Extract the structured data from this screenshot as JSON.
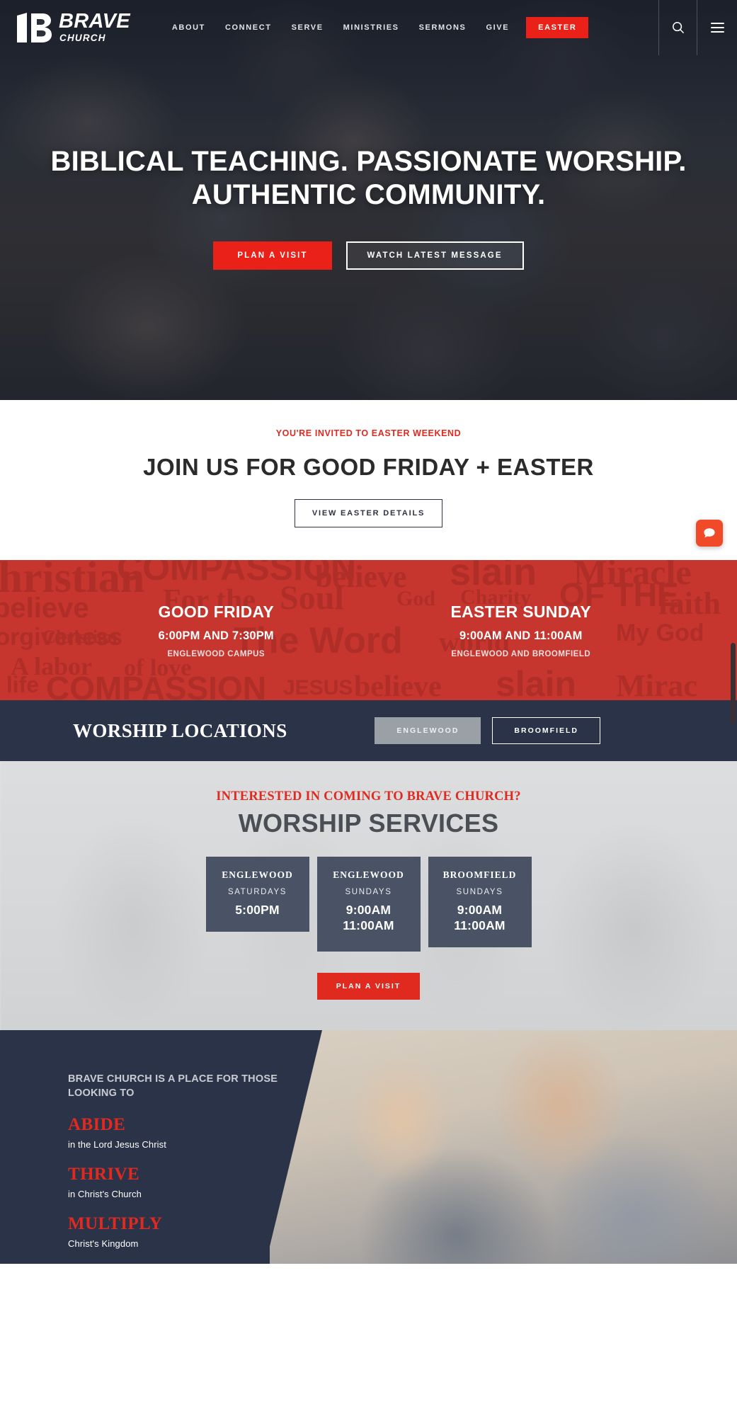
{
  "nav": {
    "logo": {
      "brand": "BRAVE",
      "sub": "CHURCH",
      "mark_icon": "brave-b-logo-icon"
    },
    "links": [
      "ABOUT",
      "CONNECT",
      "SERVE",
      "MINISTRIES",
      "SERMONS",
      "GIVE"
    ],
    "cta": "EASTER",
    "search_icon": "search-icon",
    "menu_icon": "hamburger-menu-icon"
  },
  "hero": {
    "title_line1": "BIBLICAL TEACHING. PASSIONATE WORSHIP.",
    "title_line2": "AUTHENTIC COMMUNITY.",
    "primary_button": "PLAN A VISIT",
    "secondary_button": "WATCH LATEST MESSAGE"
  },
  "invite": {
    "eyebrow": "YOU'RE INVITED TO EASTER WEEKEND",
    "headline": "JOIN US FOR GOOD FRIDAY + EASTER",
    "button": "VIEW EASTER DETAILS"
  },
  "easter_band": {
    "accent_color": "#c6352e",
    "columns": [
      {
        "title": "GOOD FRIDAY",
        "times": "6:00PM AND 7:30PM",
        "campus": "ENGLEWOOD CAMPUS"
      },
      {
        "title": "EASTER SUNDAY",
        "times": "9:00AM AND 11:00AM",
        "campus": "ENGLEWOOD AND BROOMFIELD"
      }
    ],
    "texture_words": [
      "COMPASSION",
      "believe",
      "slain",
      "For the",
      "Soul",
      "The Word",
      "COMPASSION",
      "A labor",
      "of love",
      "JESUS",
      "God",
      "Charity",
      "OF THE",
      "faith",
      "Christian",
      "forgiveness",
      "My God",
      "Miracle",
      "life",
      "christian"
    ]
  },
  "locations_bar": {
    "title": "WORSHIP LOCATIONS",
    "tabs": [
      {
        "label": "ENGLEWOOD",
        "active": true
      },
      {
        "label": "BROOMFIELD",
        "active": false
      }
    ]
  },
  "services": {
    "eyebrow": "INTERESTED IN COMING TO BRAVE CHURCH?",
    "headline": "WORSHIP SERVICES",
    "cards": [
      {
        "campus": "ENGLEWOOD",
        "day": "SATURDAYS",
        "times": "5:00PM"
      },
      {
        "campus": "ENGLEWOOD",
        "day": "SUNDAYS",
        "times": "9:00AM\n11:00AM"
      },
      {
        "campus": "BROOMFIELD",
        "day": "SUNDAYS",
        "times": "9:00AM\n11:00AM"
      }
    ],
    "button": "PLAN A VISIT"
  },
  "abide": {
    "intro": "BRAVE CHURCH IS A PLACE FOR THOSE LOOKING TO",
    "items": [
      {
        "word": "ABIDE",
        "sub": "in the Lord Jesus Christ"
      },
      {
        "word": "THRIVE",
        "sub": "in Christ's Church"
      },
      {
        "word": "MULTIPLY",
        "sub": "Christ's Kingdom"
      }
    ],
    "accent_color": "#e02a20"
  },
  "widgets": {
    "chat_icon": "chat-bubble-icon"
  }
}
